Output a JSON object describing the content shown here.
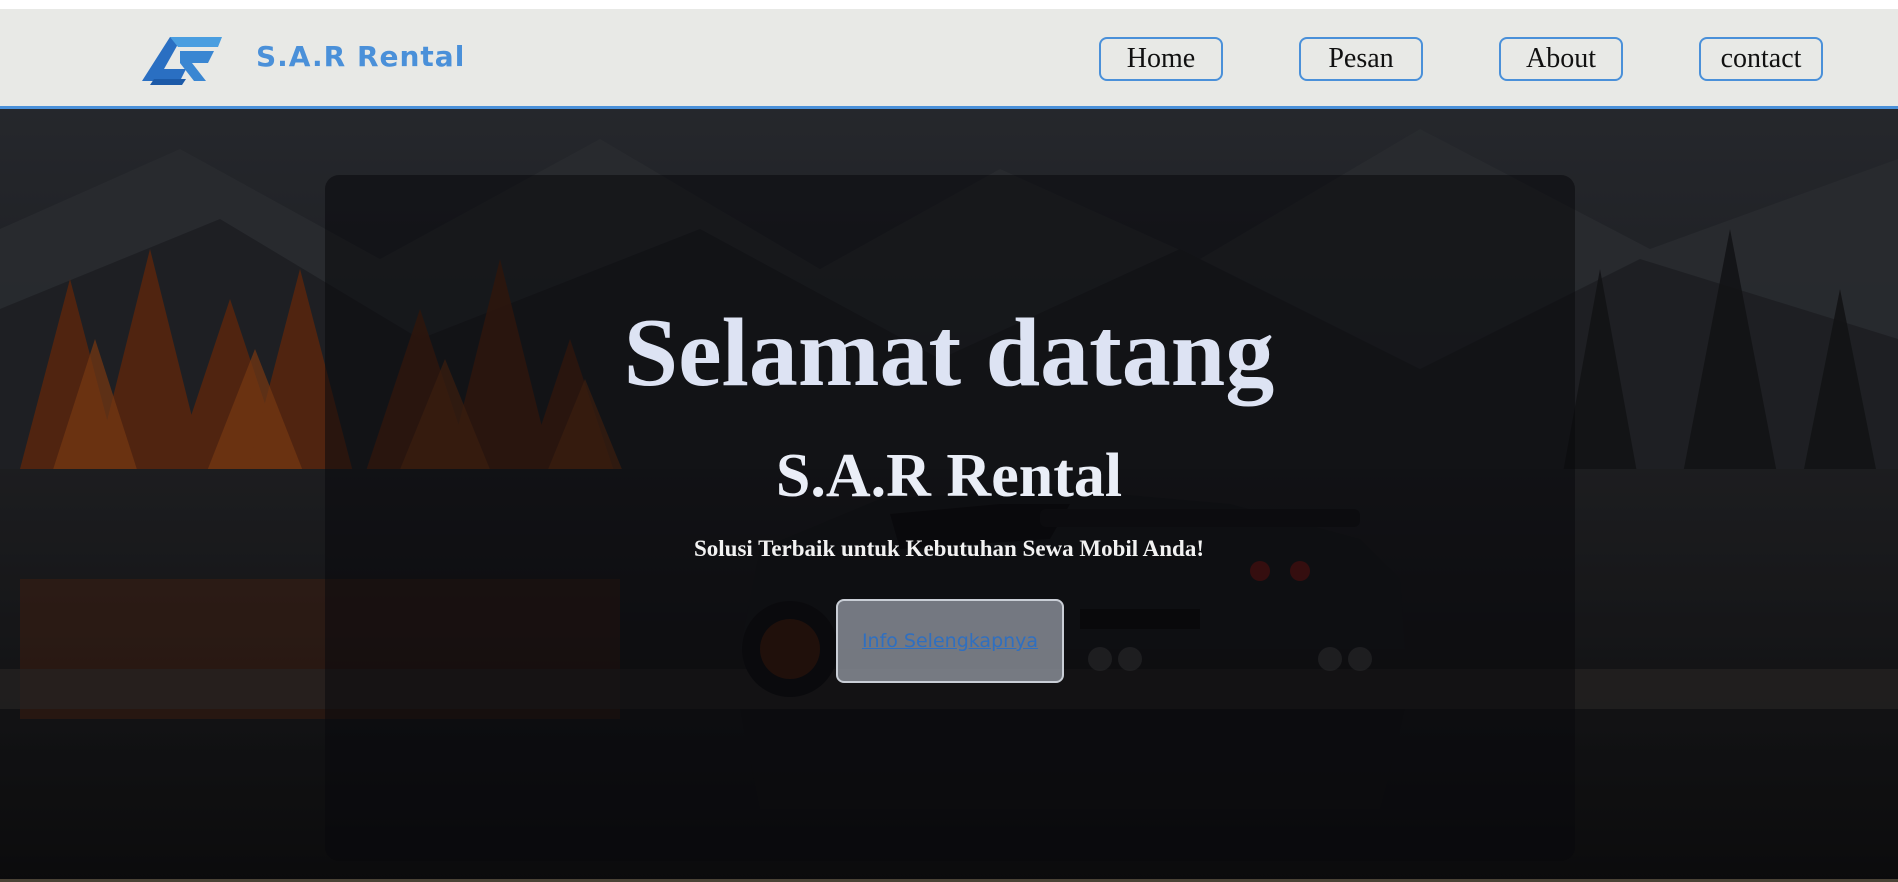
{
  "navbar": {
    "brand": "S.A.R Rental",
    "logo_icon": "sar-logo-icon",
    "links": [
      {
        "label": "Home"
      },
      {
        "label": "Pesan"
      },
      {
        "label": "About"
      },
      {
        "label": "contact"
      }
    ]
  },
  "hero": {
    "headline": "Selamat datang",
    "subtitle": "S.A.R Rental",
    "tagline": "Solusi Terbaik untuk Kebutuhan Sewa Mobil Anda!",
    "cta_label": "Info Selengkapnya",
    "background": "mountain-lake-car-image"
  },
  "colors": {
    "accent": "#4a90d9",
    "navbar_bg": "#e8e9e6",
    "headline_text": "#dde3f3"
  }
}
